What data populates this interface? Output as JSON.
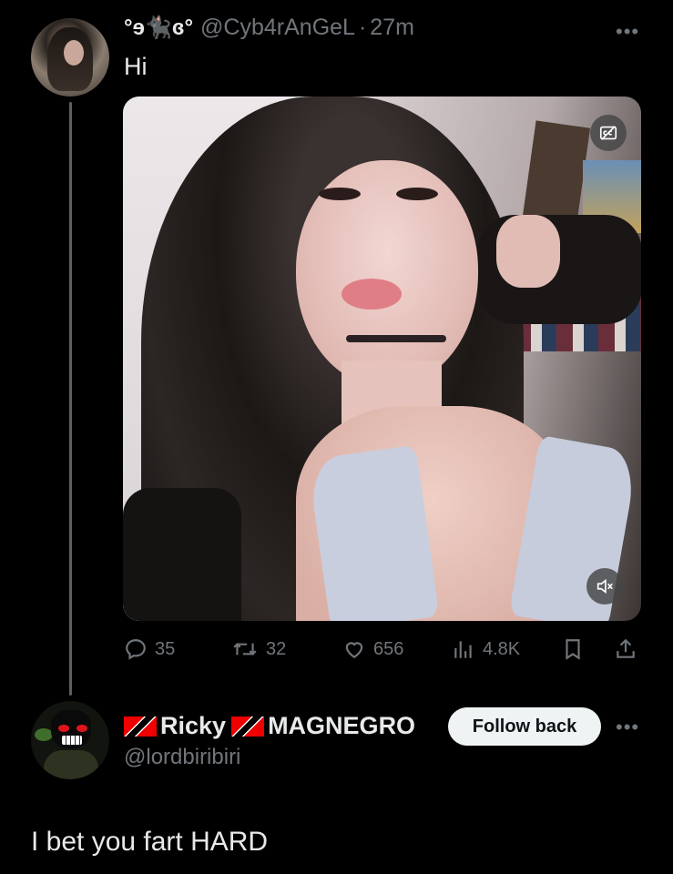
{
  "tweet": {
    "display_name": "°ɘ🐈‍⬛ɞ°",
    "handle": "@Cyb4rAnGeL",
    "separator": "·",
    "time": "27m",
    "text": "Hi",
    "more_icon": "more-icon",
    "media": {
      "cc_icon": "captions-off-icon",
      "mute_icon": "volume-muted-icon"
    },
    "actions": {
      "replies": "35",
      "reposts": "32",
      "likes": "656",
      "views": "4.8K"
    }
  },
  "reply": {
    "display_name_part1": "Ricky",
    "display_name_part2": "MAGNEGRO",
    "handle": "@lordbiribiri",
    "follow_label": "Follow back",
    "text": "I bet you fart HARD"
  },
  "colors": {
    "background": "#000000",
    "text_primary": "#e7e9ea",
    "text_secondary": "#71767b",
    "button_bg": "#eff3f4"
  }
}
